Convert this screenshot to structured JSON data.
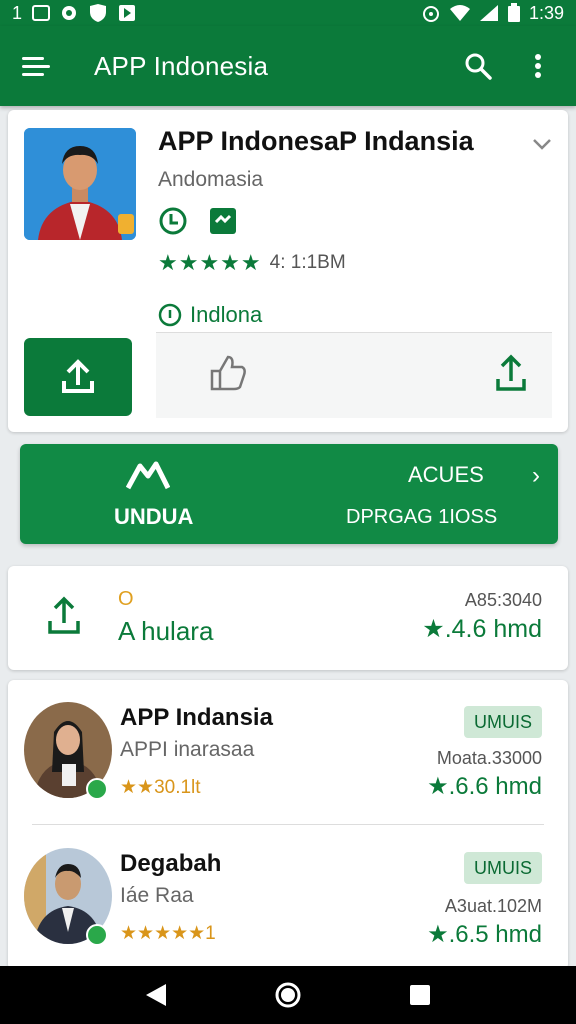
{
  "status_bar": {
    "left_text": "1",
    "time": "1:39"
  },
  "app_bar": {
    "title": "APP Indonesia"
  },
  "detail": {
    "app_name": "APP IndonesaP Indansia",
    "developer": "Andomasia",
    "rating_text": "4: 1:1BM",
    "rating_stars": "★★★★★",
    "rating_value": 4.5,
    "category": "Indlona"
  },
  "banner": {
    "button_label": "UNDUA",
    "access_label": "ACUES",
    "sub_label": "DPRGAG 1IOSS",
    "arrow": "›"
  },
  "share_card": {
    "dot": "O",
    "label": "A hulara",
    "meta": "A85:3040",
    "rating": "★.4.6 hmd"
  },
  "list": [
    {
      "name": "APP Indansia",
      "subtitle": "APPI inarasaa",
      "stars": "★★30.1lt",
      "button": "UMUIS",
      "meta": "Moata.33000",
      "rating": "★.6.6 hmd"
    },
    {
      "name": "Degabah",
      "subtitle": "Iáe Raa",
      "stars": "★★★★★1",
      "button": "UMUIS",
      "meta": "A3uat.102M",
      "rating": "★.6.5 hmd"
    }
  ],
  "colors": {
    "primary": "#0b7a3a",
    "banner": "#118a45",
    "accent_gold": "#d9951a"
  }
}
